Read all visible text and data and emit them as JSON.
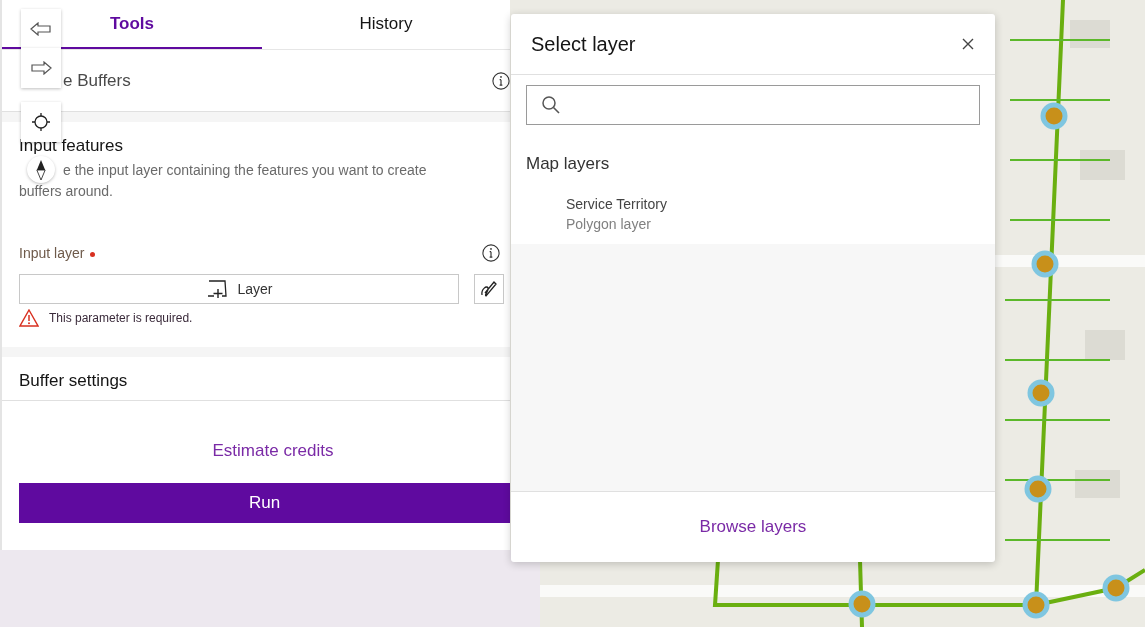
{
  "tabs": [
    {
      "label": "Tools",
      "selected": true
    },
    {
      "label": "History",
      "selected": false
    }
  ],
  "tool": {
    "title": "e Buffers"
  },
  "sections": [
    {
      "heading": "Input features",
      "description": [
        "e the input layer containing the features you want to create",
        "buffers around."
      ],
      "parameter": {
        "label": "Input layer",
        "required": true,
        "button": "Layer",
        "error": "This parameter is required."
      }
    },
    {
      "heading": "Buffer settings"
    }
  ],
  "footer": {
    "link": "Estimate credits",
    "button": "Run"
  },
  "dialog": {
    "title": "Select layer",
    "group": "Map layers",
    "layers": [
      {
        "name": "Service Territory",
        "type": "Polygon layer"
      }
    ],
    "footer_link": "Browse layers"
  }
}
